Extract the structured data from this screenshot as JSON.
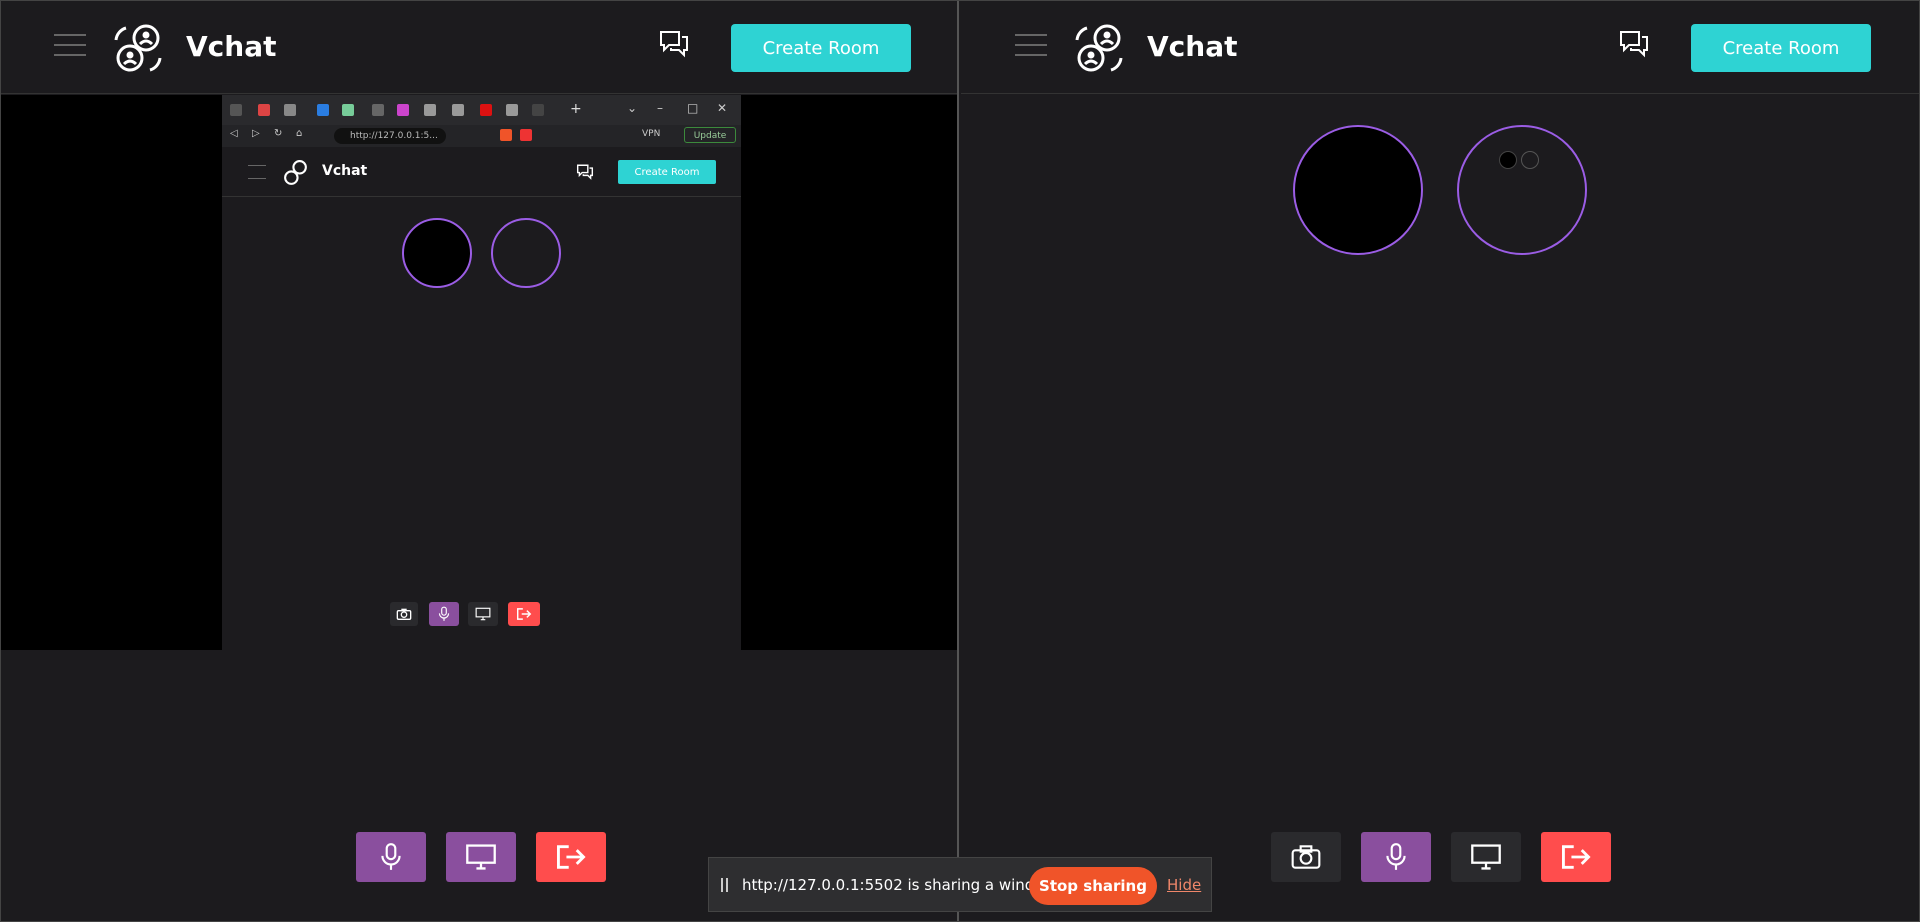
{
  "app": {
    "brand": "Vchat",
    "create_room_label": "Create Room"
  },
  "inner_browser": {
    "url": "http://127.0.0.1:5...",
    "vpn_label": "VPN",
    "update_label": "Update",
    "new_tab_label": "+",
    "brand": "Vchat",
    "create_room_label": "Create Room"
  },
  "share_bar": {
    "text": "http://127.0.0.1:5502 is sharing a window.",
    "stop_label": "Stop sharing",
    "hide_label": "Hide"
  },
  "colors": {
    "accent": "#2ed3d3",
    "purple": "#8a4f9e",
    "red": "#ff4d4d",
    "ring": "#9b5de5",
    "stop": "#f05429"
  }
}
